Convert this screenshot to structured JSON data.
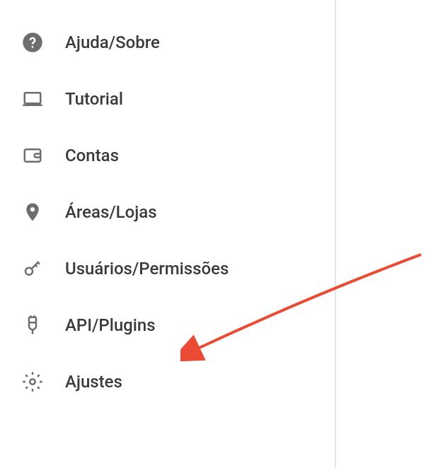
{
  "sidebar": {
    "items": [
      {
        "label": "Ajuda/Sobre"
      },
      {
        "label": "Tutorial"
      },
      {
        "label": "Contas"
      },
      {
        "label": "Áreas/Lojas"
      },
      {
        "label": "Usuários/Permissões"
      },
      {
        "label": "API/Plugins"
      },
      {
        "label": "Ajustes"
      }
    ]
  }
}
